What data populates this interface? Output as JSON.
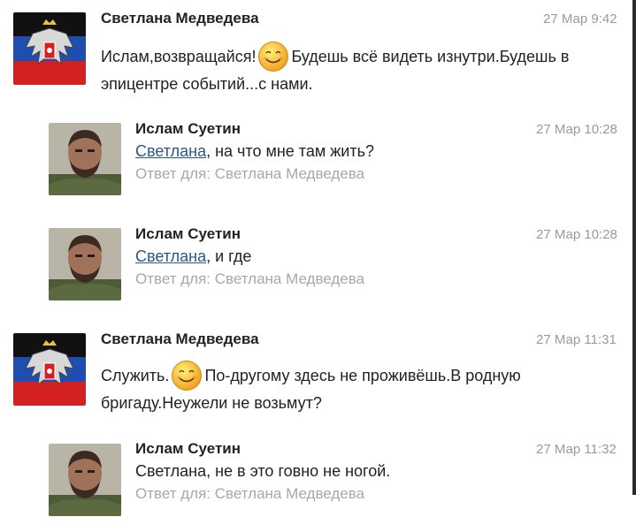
{
  "messages": [
    {
      "author": "Светлана Медведева",
      "time": "27 Мар 9:42",
      "avatar": "dpr-flag-emblem",
      "line1_a": "Ислам,возвращайся!",
      "line1_b": "Будешь всё видеть изнутри.Будешь в",
      "line2": "эпицентре событий...с нами."
    },
    {
      "author": "Ислам Суетин",
      "time": "27 Мар 10:28",
      "avatar": "man-portrait",
      "mention": "Светлана",
      "text": ", на что мне там жить?",
      "reply": "Ответ для: Светлана Медведева"
    },
    {
      "author": "Ислам Суетин",
      "time": "27 Мар 10:28",
      "avatar": "man-portrait",
      "mention": "Светлана",
      "text": ", и где",
      "reply": "Ответ для: Светлана Медведева"
    },
    {
      "author": "Светлана Медведева",
      "time": "27 Мар 11:31",
      "avatar": "dpr-flag-emblem",
      "line1_a": "Служить.",
      "line1_b": "По-другому здесь не проживёшь.В родную",
      "line2": "бригаду.Неужели не возьмут?"
    },
    {
      "author": "Ислам Суетин",
      "time": "27 Мар 11:32",
      "avatar": "man-portrait",
      "text": "Светлана, не в это говно не ногой.",
      "reply": "Ответ для: Светлана Медведева"
    }
  ],
  "icons": {
    "emoji": "smiley-face-icon"
  },
  "colors": {
    "link": "#2a5885",
    "meta": "#9a9a9a",
    "reply": "#a8a8a8",
    "flag_black": "#111111",
    "flag_blue": "#1e4fb0",
    "flag_red": "#d42020"
  }
}
